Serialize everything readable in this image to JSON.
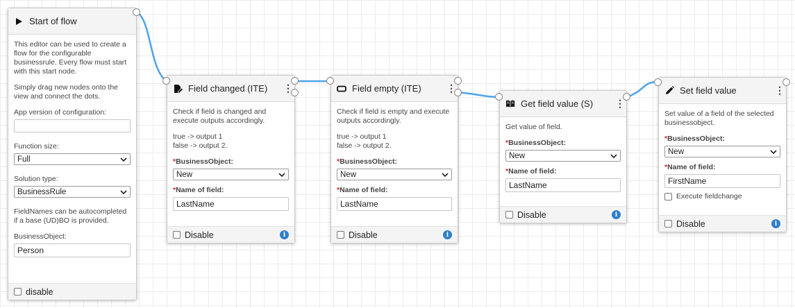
{
  "start": {
    "title": "Start of flow",
    "desc": "This editor can be used to create a flow for the configurable businessrule. Every flow must start with this start node.",
    "desc2": "Simply drag new nodes onto the view and connect the dots.",
    "app_version_label": "App version of configuration:",
    "app_version_value": "",
    "function_size_label": "Function size:",
    "function_size_value": "Full",
    "solution_type_label": "Solution type:",
    "solution_type_value": "BusinessRule",
    "fieldnames_note": "FieldNames can be autocompleted if a base (UD)BO is provided.",
    "bo_label": "BusinessObject:",
    "bo_value": "Person",
    "disable_label": "disable"
  },
  "field_changed": {
    "title": "Field changed (ITE)",
    "desc": "Check if field is changed and execute outputs accordingly.",
    "outputs": "true -> output 1\nfalse -> output 2.",
    "bo_label": "BusinessObject:",
    "bo_value": "New",
    "field_label": "Name of field:",
    "field_value": "LastName",
    "disable_label": "Disable"
  },
  "field_empty": {
    "title": "Field empty (ITE)",
    "desc": "Check if field is empty and execute outputs accordingly.",
    "outputs": "true -> output 1\nfalse -> output 2.",
    "bo_label": "BusinessObject:",
    "bo_value": "New",
    "field_label": "Name of field:",
    "field_value": "LastName",
    "disable_label": "Disable"
  },
  "get_field": {
    "title": "Get field value (S)",
    "desc": "Get value of field.",
    "bo_label": "BusinessObject:",
    "bo_value": "New",
    "field_label": "Name of field:",
    "field_value": "LastName",
    "disable_label": "Disable"
  },
  "set_field": {
    "title": "Set field value",
    "desc": "Set value of a field of the selected businessobject.",
    "bo_label": "BusinessObject:",
    "bo_value": "New",
    "field_label": "Name of field:",
    "field_value": "FirstName",
    "exec_label": "Execute fieldchange",
    "disable_label": "Disable"
  },
  "req_marker": "*",
  "menu_glyph": "⋮",
  "info_glyph": "i",
  "colors": {
    "wire": "#4da3ec",
    "info": "#2f7fc9",
    "required": "#c62828"
  }
}
